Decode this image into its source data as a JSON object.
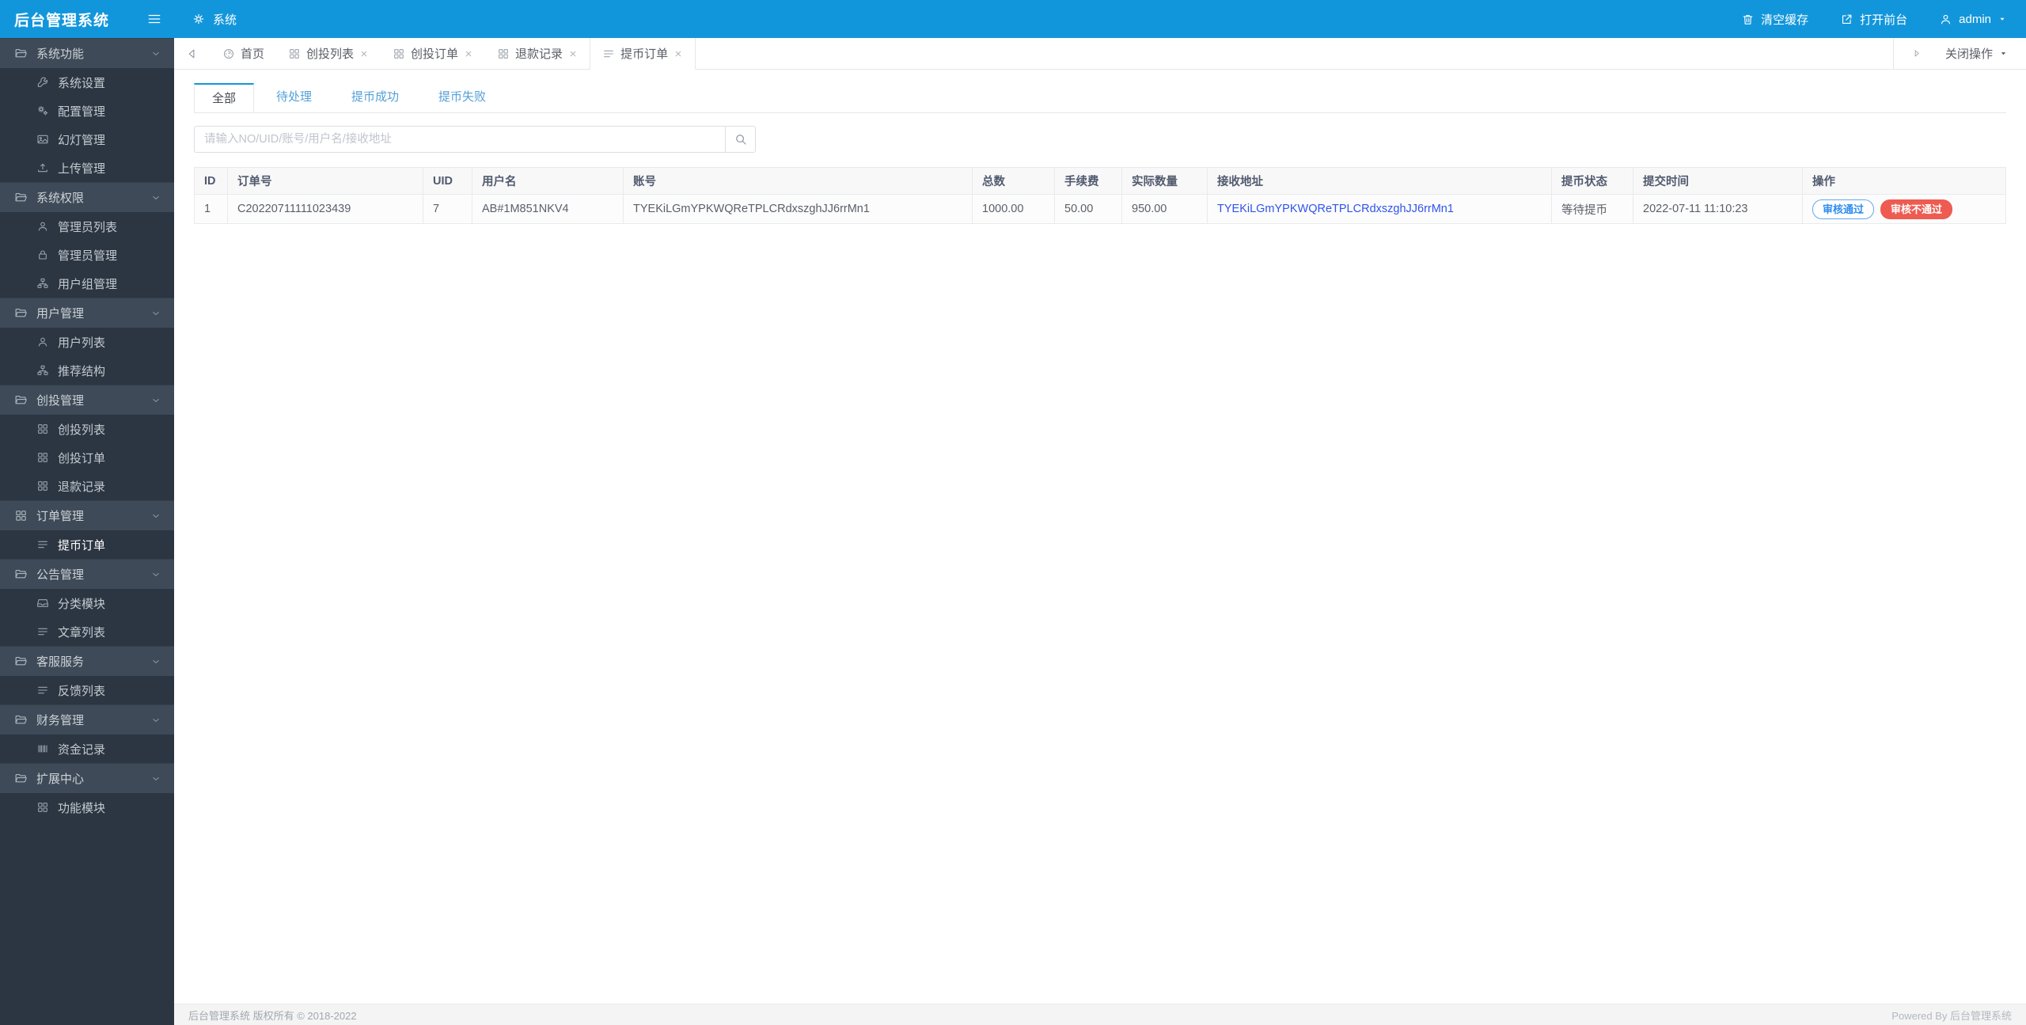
{
  "app": {
    "title": "后台管理系统"
  },
  "colors": {
    "primary": "#1296db",
    "danger": "#ed5b51",
    "amount_red": "#ed4014",
    "link_blue": "#2f54eb"
  },
  "topbar": {
    "breadcrumb": "系统",
    "actions": [
      {
        "icon": "trash",
        "label": "清空缓存"
      },
      {
        "icon": "external",
        "label": "打开前台"
      },
      {
        "icon": "user",
        "label": "admin",
        "caret": true
      }
    ]
  },
  "tabbar": {
    "tabs": [
      {
        "icon": "dashboard",
        "label": "首页",
        "closable": false,
        "active": false
      },
      {
        "icon": "grid",
        "label": "创投列表",
        "closable": true,
        "active": false
      },
      {
        "icon": "grid",
        "label": "创投订单",
        "closable": true,
        "active": false
      },
      {
        "icon": "grid",
        "label": "退款记录",
        "closable": true,
        "active": false
      },
      {
        "icon": "list",
        "label": "提币订单",
        "closable": true,
        "active": true
      }
    ],
    "close_menu_label": "关闭操作"
  },
  "sidebar": {
    "groups": [
      {
        "icon": "folder",
        "label": "系统功能",
        "children": [
          {
            "icon": "wrench",
            "label": "系统设置"
          },
          {
            "icon": "gears",
            "label": "配置管理"
          },
          {
            "icon": "image",
            "label": "幻灯管理"
          },
          {
            "icon": "upload",
            "label": "上传管理"
          }
        ]
      },
      {
        "icon": "folder",
        "label": "系统权限",
        "children": [
          {
            "icon": "user",
            "label": "管理员列表"
          },
          {
            "icon": "lock",
            "label": "管理员管理"
          },
          {
            "icon": "sitemap",
            "label": "用户组管理"
          }
        ]
      },
      {
        "icon": "folder",
        "label": "用户管理",
        "children": [
          {
            "icon": "user",
            "label": "用户列表"
          },
          {
            "icon": "sitemap",
            "label": "推荐结构"
          }
        ]
      },
      {
        "icon": "folder",
        "label": "创投管理",
        "children": [
          {
            "icon": "grid",
            "label": "创投列表"
          },
          {
            "icon": "grid",
            "label": "创投订单"
          },
          {
            "icon": "grid",
            "label": "退款记录"
          }
        ]
      },
      {
        "icon": "grid",
        "label": "订单管理",
        "children": [
          {
            "icon": "list",
            "label": "提币订单",
            "active": true
          }
        ]
      },
      {
        "icon": "folder",
        "label": "公告管理",
        "children": [
          {
            "icon": "inbox",
            "label": "分类模块"
          },
          {
            "icon": "list",
            "label": "文章列表"
          }
        ]
      },
      {
        "icon": "folder",
        "label": "客服服务",
        "children": [
          {
            "icon": "list",
            "label": "反馈列表"
          }
        ]
      },
      {
        "icon": "folder",
        "label": "财务管理",
        "children": [
          {
            "icon": "barcode",
            "label": "资金记录"
          }
        ]
      },
      {
        "icon": "folder",
        "label": "扩展中心",
        "children": [
          {
            "icon": "grid",
            "label": "功能模块"
          }
        ]
      }
    ]
  },
  "filters": {
    "tabs": [
      {
        "label": "全部",
        "active": true
      },
      {
        "label": "待处理",
        "active": false
      },
      {
        "label": "提币成功",
        "active": false
      },
      {
        "label": "提币失败",
        "active": false
      }
    ]
  },
  "search": {
    "placeholder": "请输入NO/UID/账号/用户名/接收地址"
  },
  "table": {
    "columns": [
      "ID",
      "订单号",
      "UID",
      "用户名",
      "账号",
      "总数",
      "手续费",
      "实际数量",
      "接收地址",
      "提币状态",
      "提交时间",
      "操作"
    ],
    "rows": [
      {
        "id": "1",
        "order_no": "C20220711111023439",
        "uid": "7",
        "username": "AB#1M851NKV4",
        "account": "TYEKiLGmYPKWQReTPLCRdxszghJJ6rrMn1",
        "total": "1000.00",
        "fee": "50.00",
        "actual": "950.00",
        "address": "TYEKiLGmYPKWQReTPLCRdxszghJJ6rrMn1",
        "status": "等待提币",
        "time": "2022-07-11 11:10:23",
        "actions": [
          {
            "label": "审核通过",
            "style": "outline"
          },
          {
            "label": "审核不通过",
            "style": "danger"
          }
        ]
      }
    ]
  },
  "footer": {
    "left": "后台管理系统 版权所有 © 2018-2022",
    "right": "Powered By 后台管理系统"
  }
}
